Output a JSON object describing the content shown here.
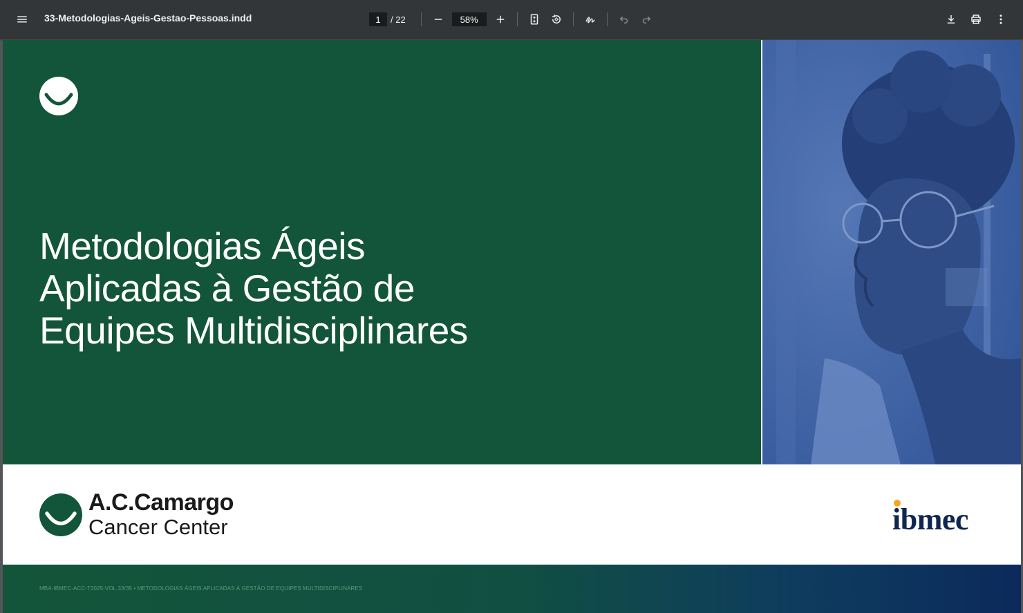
{
  "toolbar": {
    "filename": "33-Metodologias-Ageis-Gestao-Pessoas.indd",
    "page_current": "1",
    "page_total": "/ 22",
    "zoom": "58%"
  },
  "document": {
    "title_lines": [
      "Metodologias Ágeis",
      "Aplicadas à Gestão de",
      "Equipes Multidisciplinares"
    ],
    "brand_line1": "A.C.Camargo",
    "brand_line2": "Cancer Center",
    "partner": "ibmec",
    "footer": "MBA-IBMEC-ACC-T2025-VOL.33/35 • METODOLOGIAS ÁGEIS APLICADAS À GESTÃO DE EQUIPES MULTIDISCIPLINARES"
  },
  "colors": {
    "toolbar_bg": "#323639",
    "brand_green": "#13553a",
    "photo_blue": "#3f62a3",
    "ibmec_navy": "#0f2750",
    "ibmec_orange": "#f5a623"
  },
  "icons": [
    "menu-icon",
    "zoom-out-icon",
    "zoom-in-icon",
    "fit-page-icon",
    "rotate-icon",
    "annotate-icon",
    "undo-icon",
    "redo-icon",
    "download-icon",
    "print-icon",
    "more-vert-icon"
  ]
}
